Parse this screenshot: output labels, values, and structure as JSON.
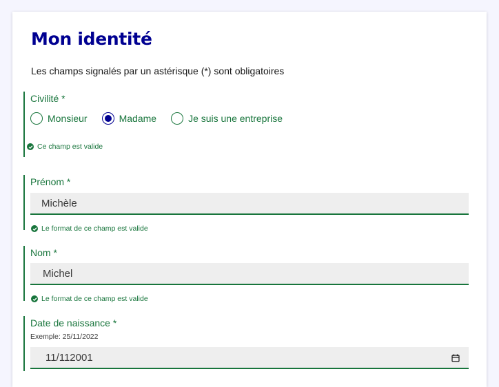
{
  "page": {
    "title": "Mon identité",
    "intro": "Les champs signalés par un astérisque (*) sont obligatoires"
  },
  "civility": {
    "label": "Civilité *",
    "options": [
      "Monsieur",
      "Madame",
      "Je suis une entreprise"
    ],
    "selected": "Madame",
    "valid_message": "Ce champ est valide"
  },
  "first_name": {
    "label": "Prénom *",
    "value": "Michèle",
    "valid_message": "Le format de ce champ est valide"
  },
  "last_name": {
    "label": "Nom *",
    "value": "Michel",
    "valid_message": "Le format de ce champ est valide"
  },
  "birth_date": {
    "label": "Date de naissance *",
    "hint": "Exemple: 25/11/2022",
    "value": "11/112001",
    "icon": "calendar-icon"
  },
  "colors": {
    "title": "#000091",
    "valid": "#18753c",
    "input_bg": "#eeeeee",
    "page_bg": "#f5f5fe"
  }
}
